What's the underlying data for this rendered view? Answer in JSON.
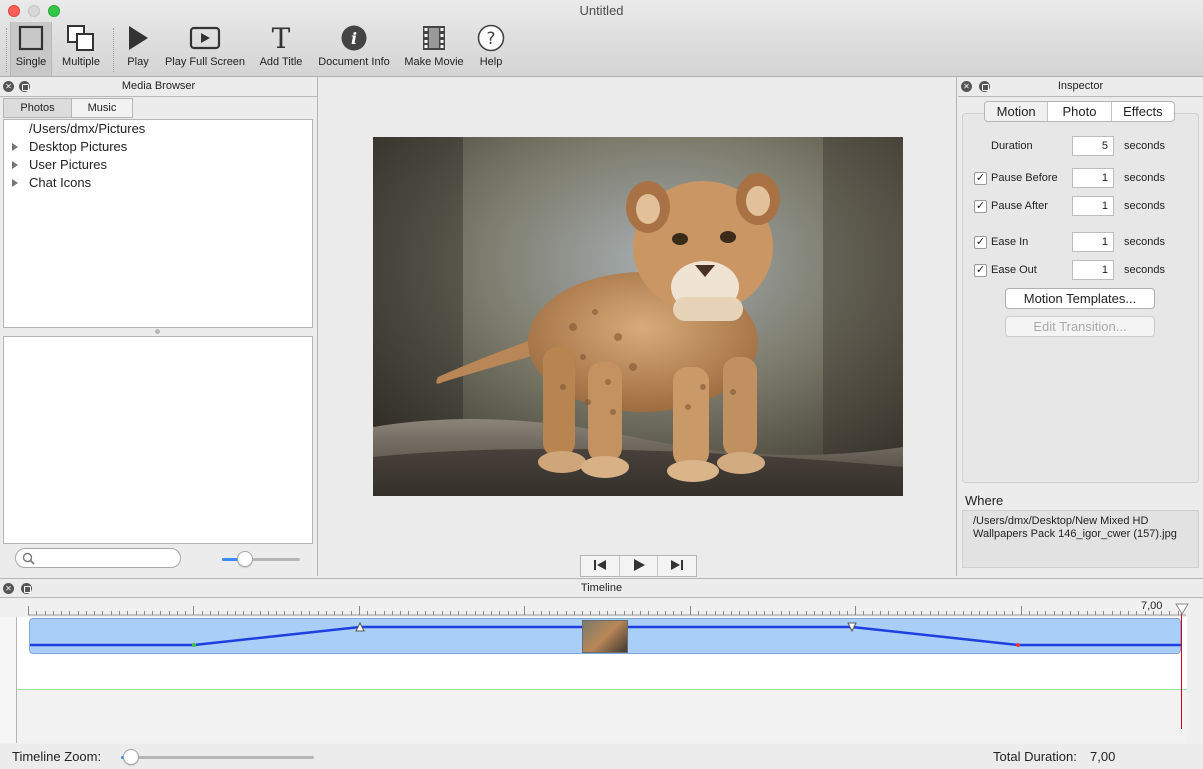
{
  "window": {
    "title": "Untitled"
  },
  "toolbar": {
    "items": [
      {
        "label": "Single",
        "icon": "single-icon"
      },
      {
        "label": "Multiple",
        "icon": "multiple-icon"
      },
      {
        "label": "Play",
        "icon": "play-icon"
      },
      {
        "label": "Play Full Screen",
        "icon": "play-full-screen-icon"
      },
      {
        "label": "Add Title",
        "icon": "add-title-icon"
      },
      {
        "label": "Document Info",
        "icon": "info-icon"
      },
      {
        "label": "Make Movie",
        "icon": "film-icon"
      },
      {
        "label": "Help",
        "icon": "help-icon"
      }
    ]
  },
  "media_browser": {
    "title": "Media Browser",
    "tabs": [
      "Photos",
      "Music"
    ],
    "tree": [
      {
        "label": "/Users/dmx/Pictures",
        "expandable": false
      },
      {
        "label": "Desktop Pictures",
        "expandable": true
      },
      {
        "label": "User Pictures",
        "expandable": true
      },
      {
        "label": "Chat Icons",
        "expandable": true
      }
    ],
    "search_placeholder": "",
    "thumbnail_size": 0.3
  },
  "inspector": {
    "title": "Inspector",
    "tabs": [
      "Motion",
      "Photo",
      "Effects"
    ],
    "duration": {
      "label": "Duration",
      "value": "5",
      "unit": "seconds"
    },
    "pause_before": {
      "label": "Pause Before",
      "value": "1",
      "unit": "seconds",
      "checked": true
    },
    "pause_after": {
      "label": "Pause After",
      "value": "1",
      "unit": "seconds",
      "checked": true
    },
    "ease_in": {
      "label": "Ease In",
      "value": "1",
      "unit": "seconds",
      "checked": true
    },
    "ease_out": {
      "label": "Ease Out",
      "value": "1",
      "unit": "seconds",
      "checked": true
    },
    "motion_templates_label": "Motion Templates...",
    "edit_transition_label": "Edit Transition...",
    "where_label": "Where",
    "where_path": "/Users/dmx/Desktop/New Mixed HD Wallpapers Pack 146_igor_cwer (157).jpg"
  },
  "timeline": {
    "title": "Timeline",
    "end_marker": "7,00",
    "zoom_label": "Timeline Zoom:",
    "zoom_level": 0.05,
    "total_duration_label": "Total Duration:",
    "total_duration_value": "7,00"
  },
  "colors": {
    "accent": "#3b8ef7",
    "clip_fill": "#a9cff8",
    "motion_line": "#1f3fe0",
    "playhead": "#d0021b"
  }
}
